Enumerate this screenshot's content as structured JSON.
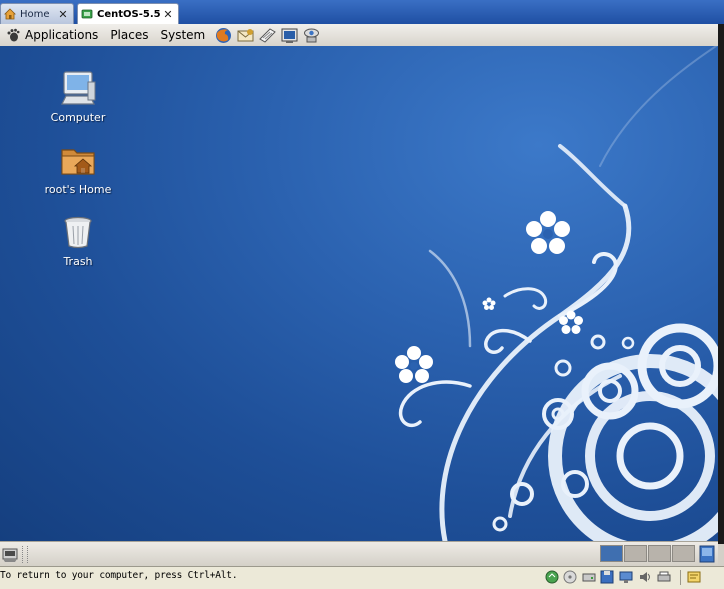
{
  "tabs": [
    {
      "label": "Home",
      "active": false,
      "icon": "home-icon"
    },
    {
      "label": "CentOS-5.5",
      "active": true,
      "icon": "vm-icon"
    }
  ],
  "panel": {
    "menus": [
      "Applications",
      "Places",
      "System"
    ],
    "launchers": [
      "firefox-icon",
      "evolution-mail-icon",
      "text-editor-icon",
      "terminal-icon",
      "network-icon"
    ]
  },
  "desktop": {
    "icons": [
      {
        "label": "Computer",
        "icon": "computer-icon"
      },
      {
        "label": "root's Home",
        "icon": "home-folder-icon"
      },
      {
        "label": "Trash",
        "icon": "trash-icon"
      }
    ]
  },
  "bottom_panel": {
    "workspaces": 4,
    "active_workspace": 1
  },
  "status_bar": {
    "message": "To return to your computer, press Ctrl+Alt."
  },
  "colors": {
    "desktop_blue": "#2b62b0",
    "tab_bar_blue": "#1f4fa3",
    "panel_gray": "#e4e1da"
  }
}
